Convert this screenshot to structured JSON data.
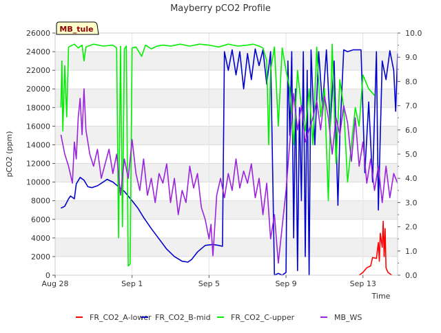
{
  "chart_data": {
    "type": "line",
    "title": "Mayberry pCO2 Profile",
    "xlabel": "Time",
    "ylabel": "pCO2 (ppm)",
    "y2label": "",
    "site_badge": "MB_tule",
    "x_range_days": [
      0,
      17.8
    ],
    "x_ticks": [
      {
        "day": 0,
        "label": "Aug 28"
      },
      {
        "day": 4,
        "label": "Sep 1"
      },
      {
        "day": 8,
        "label": "Sep 5"
      },
      {
        "day": 12,
        "label": "Sep 9"
      },
      {
        "day": 16,
        "label": "Sep 13"
      }
    ],
    "ylim": [
      0,
      26000
    ],
    "y_ticks": [
      0,
      2000,
      4000,
      6000,
      8000,
      10000,
      12000,
      14000,
      16000,
      18000,
      20000,
      22000,
      24000,
      26000
    ],
    "y2lim": [
      0,
      10
    ],
    "y2_ticks": [
      "0.0",
      "1.0",
      "2.0",
      "3.0",
      "4.0",
      "5.0",
      "6.0",
      "7.0",
      "8.0",
      "9.0",
      "10.0"
    ],
    "grid": true,
    "legend_position": "bottom",
    "series": [
      {
        "name": "FR_CO2_A-lower",
        "color": "#ff0000",
        "axis": "left",
        "points": [
          [
            15.8,
            0
          ],
          [
            16.0,
            300
          ],
          [
            16.2,
            800
          ],
          [
            16.4,
            1000
          ],
          [
            16.5,
            1900
          ],
          [
            16.7,
            1800
          ],
          [
            16.8,
            3500
          ],
          [
            16.85,
            1500
          ],
          [
            16.9,
            4500
          ],
          [
            17.0,
            3000
          ],
          [
            17.05,
            5800
          ],
          [
            17.1,
            2000
          ],
          [
            17.15,
            5000
          ],
          [
            17.2,
            800
          ],
          [
            17.3,
            300
          ],
          [
            17.5,
            0
          ]
        ]
      },
      {
        "name": "FR_CO2_B-mid",
        "color": "#0000cc",
        "axis": "left",
        "points": [
          [
            0.3,
            7200
          ],
          [
            0.5,
            7400
          ],
          [
            0.7,
            8200
          ],
          [
            0.8,
            8500
          ],
          [
            1.0,
            8200
          ],
          [
            1.1,
            9800
          ],
          [
            1.3,
            10500
          ],
          [
            1.5,
            10200
          ],
          [
            1.7,
            9500
          ],
          [
            1.9,
            9400
          ],
          [
            2.2,
            9600
          ],
          [
            2.5,
            10000
          ],
          [
            2.7,
            10300
          ],
          [
            3.0,
            10000
          ],
          [
            3.3,
            9500
          ],
          [
            3.6,
            9000
          ],
          [
            4.0,
            8000
          ],
          [
            4.3,
            7200
          ],
          [
            4.6,
            6200
          ],
          [
            5.0,
            5000
          ],
          [
            5.4,
            3900
          ],
          [
            5.8,
            2800
          ],
          [
            6.2,
            2000
          ],
          [
            6.6,
            1500
          ],
          [
            6.9,
            1400
          ],
          [
            7.1,
            1700
          ],
          [
            7.4,
            2500
          ],
          [
            7.8,
            3200
          ],
          [
            8.2,
            3300
          ],
          [
            8.5,
            3200
          ],
          [
            8.7,
            3100
          ],
          [
            8.8,
            24000
          ],
          [
            9.0,
            22000
          ],
          [
            9.2,
            24200
          ],
          [
            9.4,
            21500
          ],
          [
            9.6,
            24000
          ],
          [
            9.8,
            20000
          ],
          [
            10.0,
            23800
          ],
          [
            10.2,
            21000
          ],
          [
            10.4,
            24300
          ],
          [
            10.6,
            22500
          ],
          [
            10.8,
            24200
          ],
          [
            11.0,
            20500
          ],
          [
            11.2,
            24000
          ],
          [
            11.3,
            12000
          ],
          [
            11.4,
            0
          ],
          [
            11.6,
            200
          ],
          [
            11.8,
            0
          ],
          [
            12.0,
            300
          ],
          [
            12.1,
            23000
          ],
          [
            12.2,
            15000
          ],
          [
            12.3,
            24000
          ],
          [
            12.4,
            4000
          ],
          [
            12.5,
            20000
          ],
          [
            12.6,
            500
          ],
          [
            12.7,
            18000
          ],
          [
            12.8,
            8000
          ],
          [
            12.9,
            24000
          ],
          [
            13.0,
            2000
          ],
          [
            13.1,
            22000
          ],
          [
            13.2,
            0
          ],
          [
            13.3,
            24200
          ],
          [
            13.5,
            14000
          ],
          [
            13.7,
            24000
          ],
          [
            13.9,
            18000
          ],
          [
            14.1,
            24200
          ],
          [
            14.3,
            16000
          ],
          [
            14.5,
            23000
          ],
          [
            14.7,
            7500
          ],
          [
            14.8,
            15000
          ],
          [
            15.0,
            24200
          ],
          [
            15.2,
            24000
          ],
          [
            15.5,
            24200
          ],
          [
            15.9,
            24200
          ],
          [
            16.1,
            11000
          ],
          [
            16.3,
            18600
          ],
          [
            16.5,
            10000
          ],
          [
            16.7,
            24000
          ],
          [
            16.8,
            7000
          ],
          [
            17.0,
            23000
          ],
          [
            17.2,
            21000
          ],
          [
            17.4,
            24100
          ],
          [
            17.6,
            22000
          ],
          [
            17.7,
            17600
          ],
          [
            17.8,
            23800
          ]
        ]
      },
      {
        "name": "FR_CO2_C-upper",
        "color": "#00ee00",
        "axis": "left",
        "points": [
          [
            0.3,
            18000
          ],
          [
            0.35,
            23000
          ],
          [
            0.4,
            15500
          ],
          [
            0.5,
            22500
          ],
          [
            0.6,
            17000
          ],
          [
            0.7,
            24500
          ],
          [
            1.0,
            24800
          ],
          [
            1.2,
            24400
          ],
          [
            1.4,
            24700
          ],
          [
            1.5,
            23000
          ],
          [
            1.6,
            24500
          ],
          [
            2.0,
            24800
          ],
          [
            2.5,
            24600
          ],
          [
            3.0,
            24700
          ],
          [
            3.2,
            24400
          ],
          [
            3.3,
            4000
          ],
          [
            3.4,
            24600
          ],
          [
            3.5,
            5200
          ],
          [
            3.6,
            24300
          ],
          [
            3.7,
            24600
          ],
          [
            3.8,
            1000
          ],
          [
            3.9,
            1200
          ],
          [
            4.0,
            24400
          ],
          [
            4.2,
            24500
          ],
          [
            4.5,
            23500
          ],
          [
            4.7,
            24700
          ],
          [
            5.0,
            24300
          ],
          [
            5.3,
            24600
          ],
          [
            5.6,
            24700
          ],
          [
            6.0,
            24600
          ],
          [
            6.5,
            24800
          ],
          [
            7.0,
            24600
          ],
          [
            7.5,
            24800
          ],
          [
            8.0,
            24700
          ],
          [
            8.5,
            24500
          ],
          [
            9.0,
            24800
          ],
          [
            9.5,
            24600
          ],
          [
            10.0,
            24700
          ],
          [
            10.3,
            24800
          ],
          [
            10.6,
            24600
          ],
          [
            10.8,
            24400
          ],
          [
            11.0,
            23000
          ],
          [
            11.1,
            14000
          ],
          [
            11.2,
            22000
          ],
          [
            11.4,
            24500
          ],
          [
            11.6,
            16000
          ],
          [
            11.8,
            24400
          ],
          [
            12.0,
            22000
          ],
          [
            12.2,
            20000
          ],
          [
            12.4,
            14000
          ],
          [
            12.6,
            22000
          ],
          [
            12.8,
            18000
          ],
          [
            13.0,
            15500
          ],
          [
            13.2,
            20000
          ],
          [
            13.4,
            14000
          ],
          [
            13.6,
            24500
          ],
          [
            13.8,
            17000
          ],
          [
            14.0,
            20000
          ],
          [
            14.2,
            8000
          ],
          [
            14.4,
            24800
          ],
          [
            14.6,
            12000
          ],
          [
            14.8,
            21000
          ],
          [
            15.0,
            18000
          ],
          [
            15.2,
            10000
          ],
          [
            15.4,
            14000
          ],
          [
            15.6,
            18000
          ],
          [
            15.8,
            16000
          ],
          [
            16.0,
            21500
          ],
          [
            16.3,
            20000
          ],
          [
            16.6,
            19300
          ]
        ]
      },
      {
        "name": "MB_WS",
        "color": "#9922dd",
        "axis": "right",
        "points": [
          [
            0.3,
            5.8
          ],
          [
            0.5,
            5.0
          ],
          [
            0.7,
            4.5
          ],
          [
            0.9,
            3.8
          ],
          [
            1.0,
            5.5
          ],
          [
            1.1,
            4.8
          ],
          [
            1.2,
            6.5
          ],
          [
            1.3,
            7.3
          ],
          [
            1.4,
            5.8
          ],
          [
            1.5,
            7.7
          ],
          [
            1.6,
            6.0
          ],
          [
            1.8,
            5.0
          ],
          [
            2.0,
            4.5
          ],
          [
            2.2,
            5.2
          ],
          [
            2.4,
            4.0
          ],
          [
            2.6,
            4.6
          ],
          [
            2.8,
            5.2
          ],
          [
            3.0,
            4.2
          ],
          [
            3.2,
            5.0
          ],
          [
            3.4,
            3.3
          ],
          [
            3.6,
            4.8
          ],
          [
            3.8,
            4.0
          ],
          [
            4.0,
            5.6
          ],
          [
            4.2,
            4.2
          ],
          [
            4.4,
            3.5
          ],
          [
            4.6,
            4.8
          ],
          [
            4.8,
            3.3
          ],
          [
            5.0,
            4.0
          ],
          [
            5.2,
            3.0
          ],
          [
            5.4,
            4.2
          ],
          [
            5.6,
            3.8
          ],
          [
            5.8,
            4.6
          ],
          [
            6.0,
            3.0
          ],
          [
            6.2,
            4.0
          ],
          [
            6.4,
            2.5
          ],
          [
            6.6,
            3.5
          ],
          [
            6.8,
            3.0
          ],
          [
            7.0,
            4.5
          ],
          [
            7.2,
            3.6
          ],
          [
            7.4,
            4.2
          ],
          [
            7.6,
            2.8
          ],
          [
            7.8,
            2.3
          ],
          [
            8.0,
            1.5
          ],
          [
            8.1,
            2.1
          ],
          [
            8.2,
            0.8
          ],
          [
            8.4,
            3.3
          ],
          [
            8.6,
            4.0
          ],
          [
            8.8,
            3.2
          ],
          [
            9.0,
            4.2
          ],
          [
            9.2,
            3.5
          ],
          [
            9.4,
            4.8
          ],
          [
            9.6,
            3.6
          ],
          [
            9.8,
            4.3
          ],
          [
            10.0,
            3.8
          ],
          [
            10.2,
            4.6
          ],
          [
            10.4,
            3.2
          ],
          [
            10.6,
            4.0
          ],
          [
            10.8,
            2.5
          ],
          [
            11.0,
            3.8
          ],
          [
            11.2,
            1.5
          ],
          [
            11.4,
            2.5
          ],
          [
            11.6,
            0.5
          ],
          [
            11.8,
            2.0
          ],
          [
            12.0,
            3.5
          ],
          [
            12.2,
            5.5
          ],
          [
            12.4,
            7.5
          ],
          [
            12.6,
            6.0
          ],
          [
            12.8,
            7.0
          ],
          [
            13.0,
            5.5
          ],
          [
            13.2,
            6.0
          ],
          [
            13.4,
            6.5
          ],
          [
            13.6,
            7.2
          ],
          [
            13.8,
            6.0
          ],
          [
            14.0,
            7.4
          ],
          [
            14.2,
            6.5
          ],
          [
            14.4,
            5.0
          ],
          [
            14.6,
            6.5
          ],
          [
            14.8,
            5.8
          ],
          [
            15.0,
            7.0
          ],
          [
            15.2,
            6.3
          ],
          [
            15.4,
            4.7
          ],
          [
            15.6,
            6.5
          ],
          [
            15.8,
            4.5
          ],
          [
            16.0,
            5.5
          ],
          [
            16.2,
            3.8
          ],
          [
            16.4,
            4.8
          ],
          [
            16.6,
            3.5
          ],
          [
            16.8,
            4.5
          ],
          [
            17.0,
            3.0
          ],
          [
            17.2,
            4.5
          ],
          [
            17.4,
            3.2
          ],
          [
            17.6,
            4.2
          ],
          [
            17.8,
            3.8
          ]
        ]
      }
    ]
  }
}
